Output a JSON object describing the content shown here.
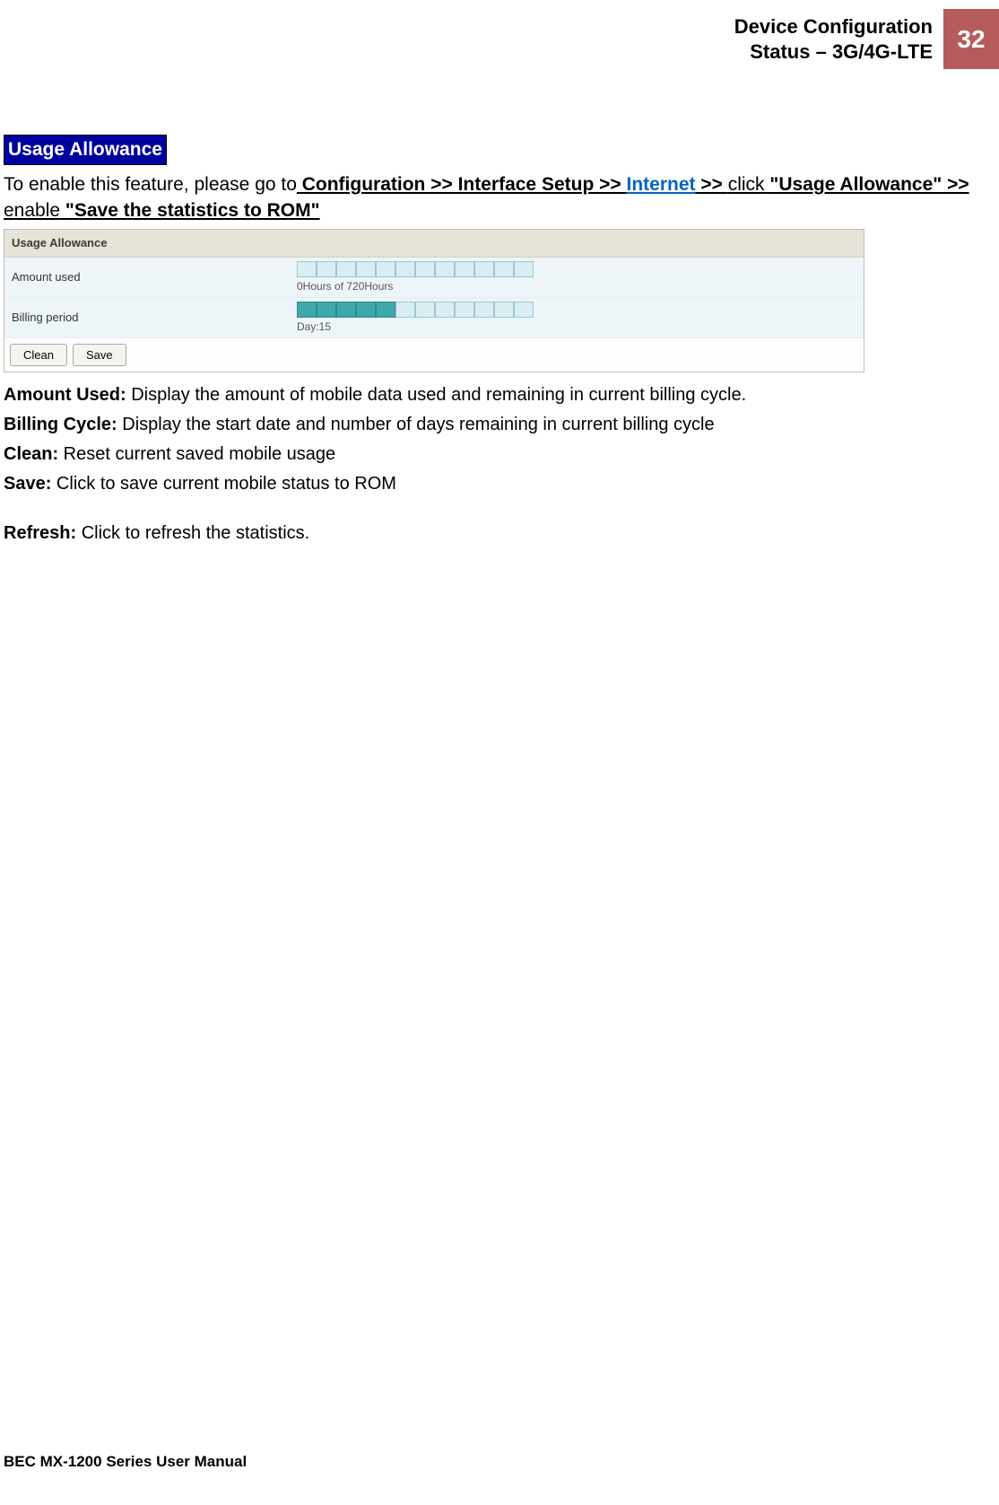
{
  "header": {
    "line1": "Device Configuration",
    "line2": "Status – 3G/4G-LTE",
    "page_number": "32"
  },
  "section": {
    "title": "Usage Allowance",
    "intro_prefix": "To enable this feature, please go to",
    "path1": " Configuration >> Interface Setup >> ",
    "path_link": "Internet",
    "path2": " >> ",
    "click_word": "click",
    "quote1": " \"Usage Allowance\" >> ",
    "enable_word": "enable",
    "quote2": " \"Save the statistics to ROM\""
  },
  "screenshot": {
    "panel_title": "Usage Allowance",
    "row1_label": "Amount used",
    "row1_caption": "0Hours of 720Hours",
    "row1_filled": 0,
    "row1_total": 12,
    "row2_label": "Billing period",
    "row2_caption": "Day:15",
    "row2_filled": 5,
    "row2_total": 12,
    "btn_clean": "Clean",
    "btn_save": "Save"
  },
  "defs": {
    "amount_used_label": "Amount Used:",
    "amount_used_text": " Display the amount of mobile data used and remaining in current billing cycle.",
    "billing_cycle_label": "Billing Cycle:",
    "billing_cycle_text": " Display the start date and number of days remaining in current billing cycle",
    "clean_label": "Clean:",
    "clean_text": " Reset current saved mobile usage",
    "save_label": "Save:",
    "save_text": " Click to save current mobile status to ROM",
    "refresh_label": "Refresh:",
    "refresh_text": " Click to refresh the statistics."
  },
  "footer": "BEC MX-1200 Series User Manual"
}
